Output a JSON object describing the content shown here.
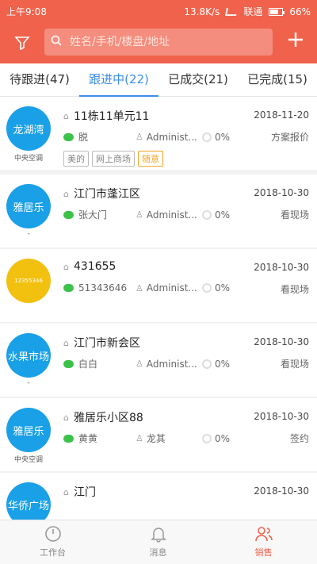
{
  "status": {
    "time": "上午9:08",
    "speed": "13.8K/s",
    "carrier": "联通",
    "battery": "66%"
  },
  "search": {
    "placeholder": "姓名/手机/楼盘/地址"
  },
  "tabs": [
    {
      "label": "待跟进(47)"
    },
    {
      "label": "跟进中(22)"
    },
    {
      "label": "已成交(21)"
    },
    {
      "label": "已完成(15)"
    }
  ],
  "rows": [
    {
      "avatar_text": "龙湖湾",
      "avatar_sub": "中央空调",
      "avatar_color": "#1aa0e6",
      "address": "11栋11单元11",
      "date": "2018-11-20",
      "contact": "脱",
      "owner": "Administ...",
      "percent": "0%",
      "stage": "方案报价",
      "tags": [
        "美的",
        "网上商场",
        "随意"
      ]
    },
    {
      "avatar_text": "雅居乐",
      "avatar_sub": "-",
      "avatar_color": "#1aa0e6",
      "address": "江门市蓬江区",
      "date": "2018-10-30",
      "contact": "张大门",
      "owner": "Administ...",
      "percent": "0%",
      "stage": "看现场"
    },
    {
      "avatar_text": "12355346",
      "avatar_sub": "",
      "avatar_color": "#f2c00f",
      "address": "431655",
      "date": "2018-10-30",
      "contact": "51343646",
      "owner": "Administ...",
      "percent": "0%",
      "stage": "看现场"
    },
    {
      "avatar_text": "水果市场",
      "avatar_sub": "-",
      "avatar_color": "#1aa0e6",
      "address": "江门市新会区",
      "date": "2018-10-30",
      "contact": "白白",
      "owner": "Administ...",
      "percent": "0%",
      "stage": "看现场"
    },
    {
      "avatar_text": "雅居乐",
      "avatar_sub": "中央空调",
      "avatar_color": "#1aa0e6",
      "address": "雅居乐小区88",
      "date": "2018-10-30",
      "contact": "黄黄",
      "owner": "龙其",
      "percent": "0%",
      "stage": "签约"
    },
    {
      "avatar_text": "华侨广场",
      "avatar_sub": "",
      "avatar_color": "#1aa0e6",
      "address": "江门",
      "date": "2018-10-30",
      "contact": "",
      "owner": "",
      "percent": "",
      "stage": ""
    }
  ],
  "bottomnav": [
    {
      "label": "工作台",
      "icon": "dashboard-icon"
    },
    {
      "label": "消息",
      "icon": "bell-icon"
    },
    {
      "label": "销售",
      "icon": "users-icon"
    }
  ],
  "colors": {
    "accent": "#f0624b",
    "tab_active": "#3d8ee8"
  }
}
